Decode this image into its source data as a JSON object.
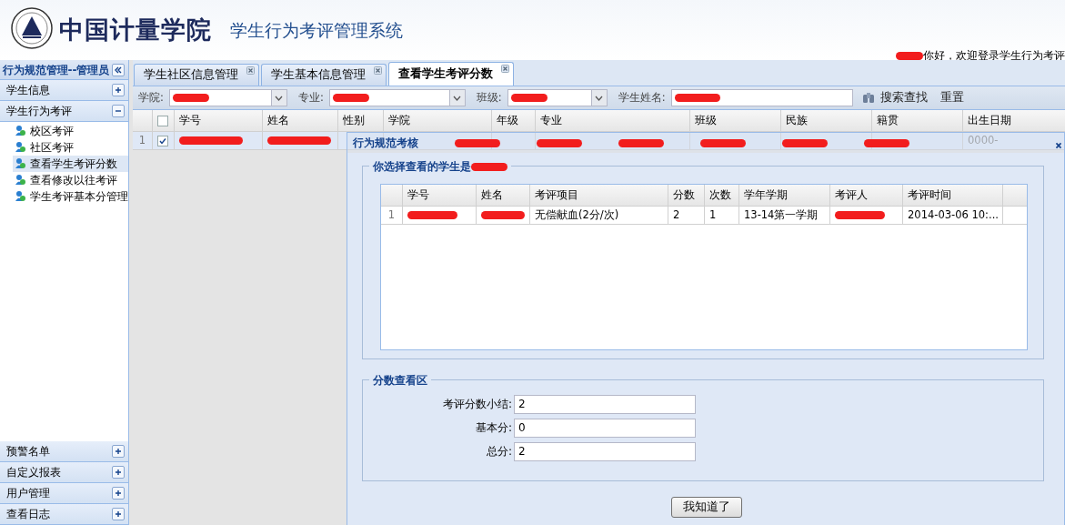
{
  "header": {
    "logo_text": "中国计量学院",
    "system_title": "学生行为考评管理系统",
    "welcome": {
      "redacted_name": true,
      "text": "你好，欢迎登录学生行为考评"
    }
  },
  "sidebar": {
    "title": "行为规范管理--管理员",
    "sections": [
      {
        "label": "学生信息",
        "expanded": false
      },
      {
        "label": "学生行为考评",
        "expanded": true,
        "items": [
          {
            "label": "校区考评",
            "selected": false
          },
          {
            "label": "社区考评",
            "selected": false
          },
          {
            "label": "查看学生考评分数",
            "selected": true
          },
          {
            "label": "查看修改以往考评",
            "selected": false
          },
          {
            "label": "学生考评基本分管理",
            "selected": false
          }
        ]
      },
      {
        "label": "预警名单",
        "expanded": false
      },
      {
        "label": "自定义报表",
        "expanded": false
      },
      {
        "label": "用户管理",
        "expanded": false
      },
      {
        "label": "查看日志",
        "expanded": false
      }
    ]
  },
  "tabs": [
    {
      "label": "学生社区信息管理",
      "selected": false
    },
    {
      "label": "学生基本信息管理",
      "selected": false
    },
    {
      "label": "查看学生考评分数",
      "selected": true
    }
  ],
  "filters": [
    {
      "label": "学院:",
      "kind": "select",
      "redacted": true
    },
    {
      "label": "专业:",
      "kind": "select",
      "redacted": true
    },
    {
      "label": "班级:",
      "kind": "select",
      "redacted": true
    },
    {
      "label": "学生姓名:",
      "kind": "text",
      "redacted": true
    }
  ],
  "toolbar_buttons": [
    {
      "label": "搜索查找",
      "kind": "search"
    },
    {
      "label": "重置",
      "kind": "plain"
    }
  ],
  "grid": {
    "all_checked": false,
    "columns": [
      "学号",
      "姓名",
      "性别",
      "学院",
      "年级",
      "专业",
      "班级",
      "民族",
      "籍贯",
      "出生日期"
    ],
    "rows": [
      {
        "number": "1",
        "checked": true,
        "cells": [
          {
            "redacted": true
          },
          {
            "redacted": true
          },
          {},
          {},
          {},
          {},
          {},
          {},
          {},
          {
            "text": "0000-"
          }
        ]
      }
    ]
  },
  "dialog": {
    "title": "行为规范考核",
    "title_marks": [
      {
        "kind": "redaction"
      },
      {
        "kind": "redaction"
      },
      {
        "kind": "redaction"
      },
      {
        "kind": "redaction"
      },
      {
        "kind": "redaction"
      },
      {
        "kind": "redaction"
      }
    ],
    "student_legend": {
      "text": "你选择查看的学生是",
      "redacted_name": true
    },
    "grid": {
      "columns": [
        "学号",
        "姓名",
        "考评项目",
        "分数",
        "次数",
        "学年学期",
        "考评人",
        "考评时间"
      ],
      "rows": [
        {
          "number": "1",
          "cells": [
            {
              "redacted": true
            },
            {
              "redacted": true
            },
            {
              "text": "无偿献血(2分/次)"
            },
            {
              "text": "2"
            },
            {
              "text": "1"
            },
            {
              "text": "13-14第一学期"
            },
            {
              "redacted": true
            },
            {
              "text": "2014-03-06 10:..."
            }
          ]
        }
      ]
    },
    "score_legend": "分数查看区",
    "fields": [
      {
        "label": "考评分数小结:",
        "value": "2"
      },
      {
        "label": "基本分:",
        "value": "0"
      },
      {
        "label": "总分:",
        "value": "2"
      }
    ],
    "button": "我知道了"
  }
}
